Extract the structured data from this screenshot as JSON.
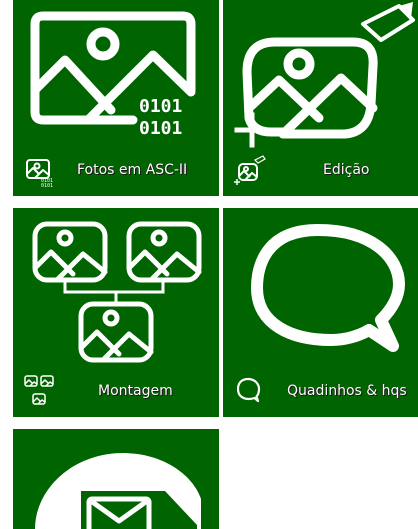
{
  "tiles": {
    "ascii": {
      "label": "Fotos em ASC-II",
      "code_line_1": "0101",
      "code_line_2": "0101",
      "icon": "image-binary-icon"
    },
    "edit": {
      "label": "Edição",
      "icon": "image-edit-icon"
    },
    "montage": {
      "label": "Montagem",
      "icon": "image-montage-icon"
    },
    "comics": {
      "label": "Quadinhos & hqs",
      "icon": "speech-bubble-icon"
    },
    "mail": {
      "icon": "mail-bubble-icon"
    }
  },
  "colors": {
    "tile_bg": "#006400",
    "icon": "#ffffff",
    "page_bg": "#ffffff"
  }
}
